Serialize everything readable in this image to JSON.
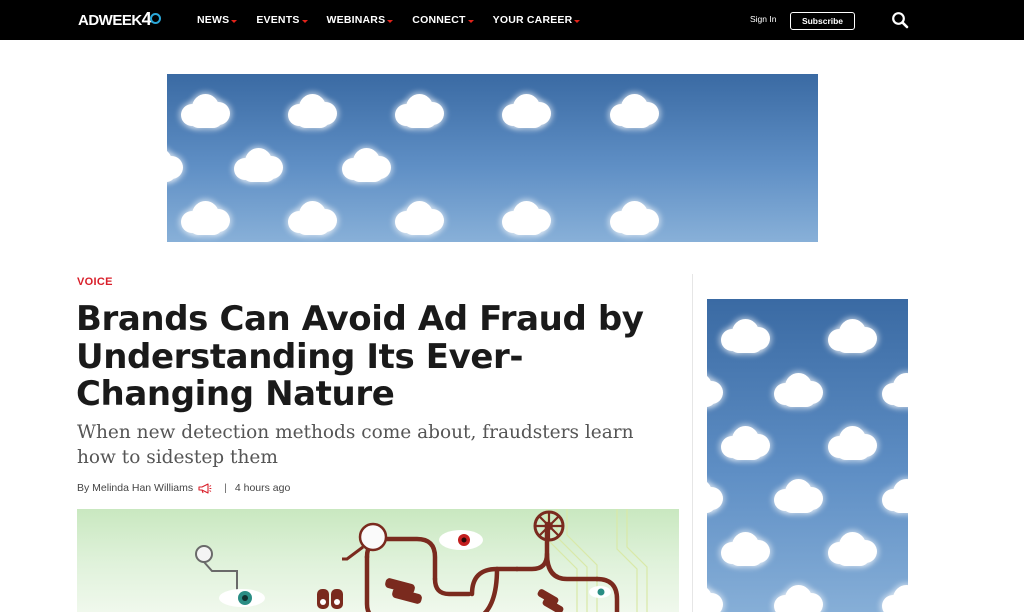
{
  "header": {
    "logo_text": "ADWEEK",
    "logo_number": "4",
    "nav": [
      {
        "label": "NEWS"
      },
      {
        "label": "EVENTS"
      },
      {
        "label": "WEBINARS"
      },
      {
        "label": "CONNECT"
      },
      {
        "label": "YOUR CAREER"
      }
    ],
    "signin_label": "Sign In",
    "subscribe_label": "Subscribe",
    "search_icon": "search-icon"
  },
  "ads": {
    "leaderboard_icon": "cloud-pattern",
    "skyscraper_icon": "cloud-pattern",
    "colors": {
      "sky_top": "#3a6aa3",
      "sky_bottom": "#88b0d8"
    }
  },
  "article": {
    "section": "VOICE",
    "headline": "Brands Can Avoid Ad Fraud by Understanding Its Ever-Changing Nature",
    "dek": "When new detection methods come about, fraudsters learn how to sidestep them",
    "byline": "By Melinda Han Williams",
    "byline_icon": "megaphone-icon",
    "separator": "|",
    "timestamp": "4 hours ago"
  },
  "colors": {
    "accent": "#d91f2a",
    "topbar": "#000000"
  }
}
